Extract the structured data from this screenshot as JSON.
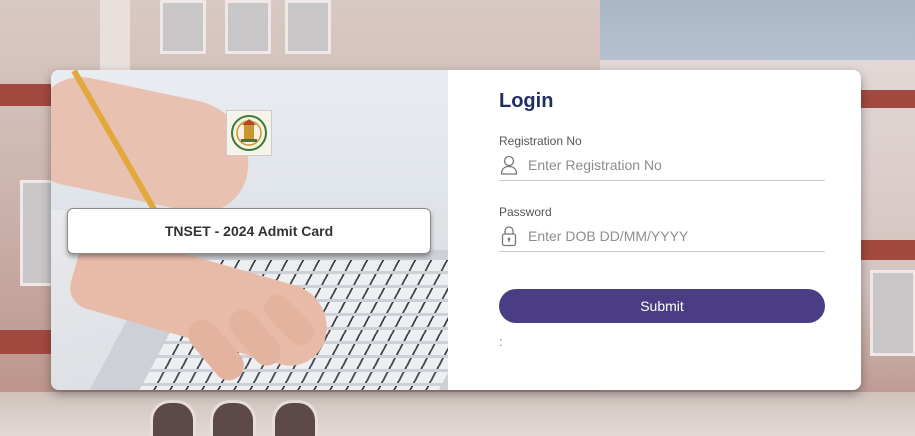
{
  "left_panel": {
    "banner": "TNSET - 2024 Admit Card",
    "logo_icon": "tamil-nadu-emblem-icon"
  },
  "login": {
    "title": "Login",
    "registration": {
      "label": "Registration No",
      "placeholder": "Enter Registration No",
      "icon": "user-icon"
    },
    "password": {
      "label": "Password",
      "placeholder": "Enter DOB DD/MM/YYYY",
      "icon": "lock-icon"
    },
    "submit_label": "Submit",
    "status_text": ":"
  },
  "colors": {
    "title": "#1f2f5e",
    "submit_button": "#4b3d83",
    "status_text": "#b8793c"
  }
}
